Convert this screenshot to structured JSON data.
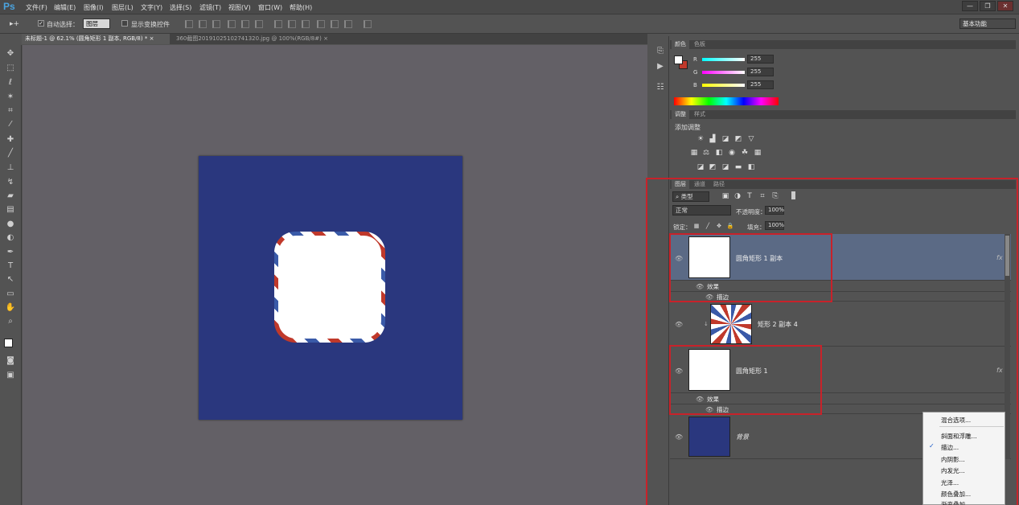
{
  "app": {
    "logo": "Ps"
  },
  "menubar": {
    "items": [
      "文件(F)",
      "编辑(E)",
      "图像(I)",
      "图层(L)",
      "文字(Y)",
      "选择(S)",
      "滤镜(T)",
      "视图(V)",
      "窗口(W)",
      "帮助(H)"
    ],
    "window_controls": {
      "minimize": "—",
      "restore": "❐",
      "close": "✕"
    }
  },
  "options": {
    "tool_glyph": "▸+",
    "auto_select_label": "自动选择：",
    "auto_select_value": "图层",
    "show_transform_label": "显示变换控件",
    "workspace": "基本功能"
  },
  "tabs": [
    {
      "label": "未标题-1 @ 62.1% (圆角矩形 1 副本, RGB/8) *",
      "close": "×",
      "active": true
    },
    {
      "label": "360截图20191025102741320.jpg @ 100%(RGB/8#)",
      "close": "×",
      "active": false
    }
  ],
  "color_panel": {
    "tabs": [
      "颜色",
      "色板"
    ],
    "channels": [
      {
        "label": "R",
        "value": "255"
      },
      {
        "label": "G",
        "value": "255"
      },
      {
        "label": "B",
        "value": "255"
      }
    ]
  },
  "adjust_panel": {
    "tabs": [
      "调整",
      "样式"
    ],
    "title": "添加调整"
  },
  "layers_panel": {
    "tabs": [
      "图层",
      "通道",
      "路径"
    ],
    "filter_kind": "类型",
    "blend_mode": "正常",
    "opacity_label": "不透明度：",
    "opacity_value": "100%",
    "lock_label": "锁定：",
    "fill_label": "填充：",
    "fill_value": "100%",
    "layers": [
      {
        "name": "圆角矩形 1 副本",
        "fx": "fx",
        "effects_label": "效果",
        "effect": "描边",
        "selected": true
      },
      {
        "name": "矩形 2 副本 4"
      },
      {
        "name": "圆角矩形 1",
        "fx": "fx",
        "effects_label": "效果",
        "effect": "描边"
      },
      {
        "name": "背景"
      }
    ]
  },
  "context_menu": {
    "items": [
      "混合选项...",
      "斜面和浮雕...",
      "描边...",
      "内阴影...",
      "内发光...",
      "光泽...",
      "颜色叠加...",
      "渐变叠加..."
    ],
    "checked_item": "描边...",
    "check_glyph": "✓"
  },
  "colors": {
    "document_bg": "#2a377e",
    "selection_highlight": "#5b6a85",
    "annotation_red": "#c8222a",
    "stroke_red": "#c0392b",
    "stroke_blue": "#3a5aa8"
  }
}
